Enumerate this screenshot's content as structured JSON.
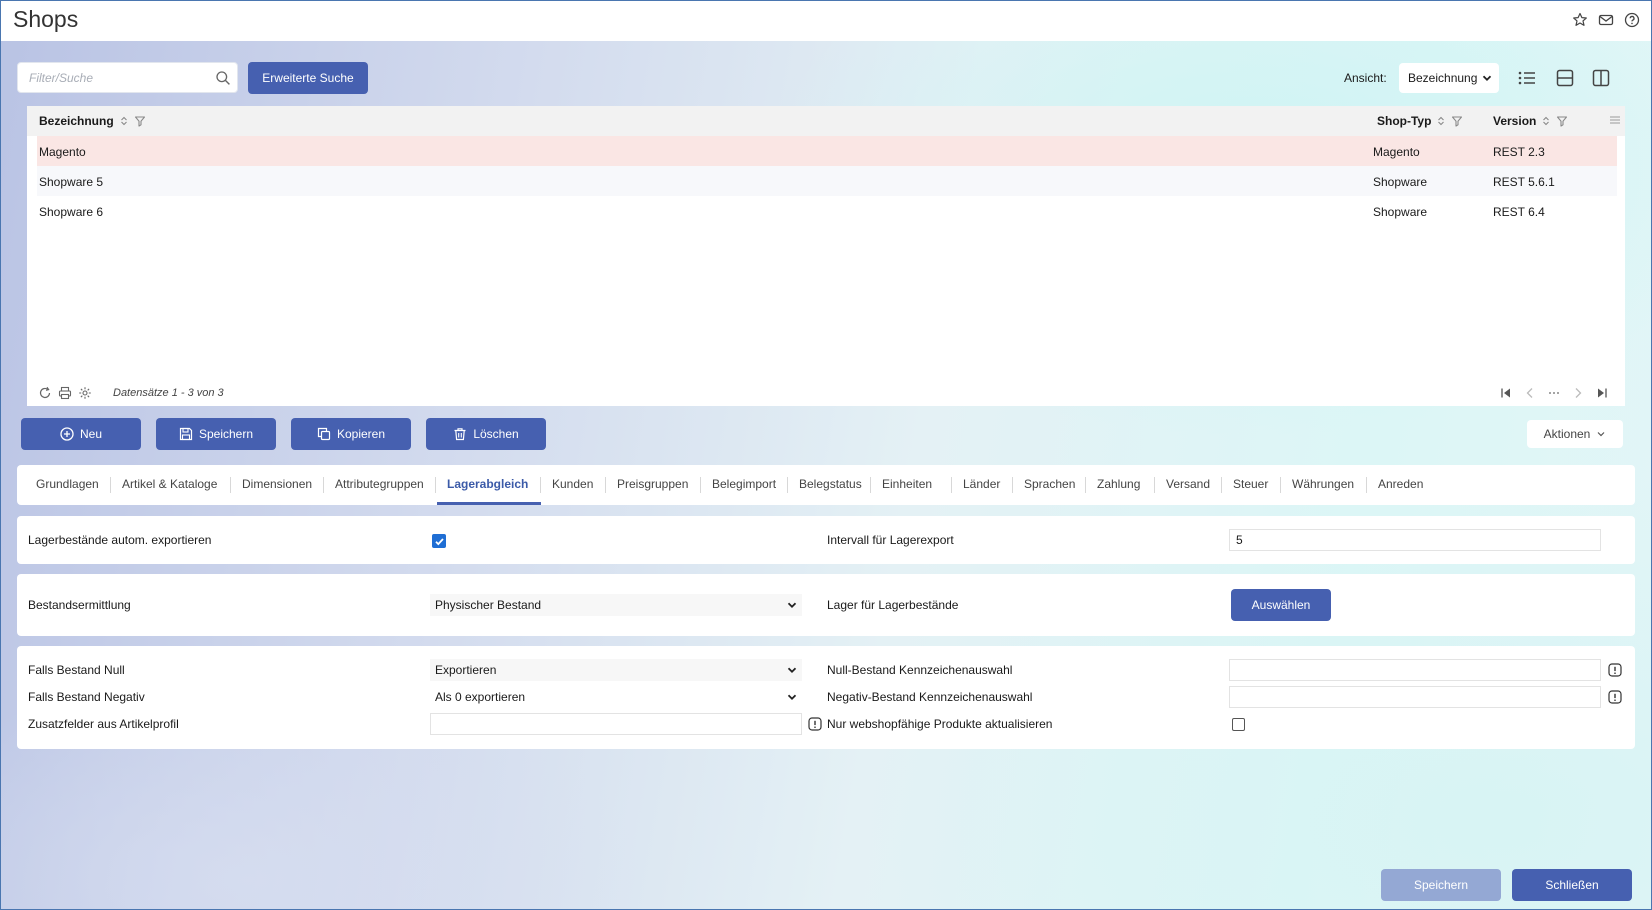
{
  "window": {
    "title": "Shops"
  },
  "search": {
    "placeholder": "Filter/Suche",
    "advanced_label": "Erweiterte Suche"
  },
  "view": {
    "label": "Ansicht:",
    "selected": "Bezeichnung"
  },
  "grid": {
    "columns": [
      "Bezeichnung",
      "Shop-Typ",
      "Version"
    ],
    "rows": [
      {
        "name": "Magento",
        "type": "Magento",
        "version": "REST 2.3",
        "selected": true
      },
      {
        "name": "Shopware 5",
        "type": "Shopware",
        "version": "REST 5.6.1",
        "selected": false
      },
      {
        "name": "Shopware 6",
        "type": "Shopware",
        "version": "REST 6.4",
        "selected": false
      }
    ],
    "records_text": "Datensätze 1 - 3 von 3"
  },
  "actions": {
    "new": "Neu",
    "save": "Speichern",
    "copy": "Kopieren",
    "delete": "Löschen",
    "more": "Aktionen"
  },
  "tabs": [
    "Grundlagen",
    "Artikel & Kataloge",
    "Dimensionen",
    "Attributegruppen",
    "Lagerabgleich",
    "Kunden",
    "Preisgruppen",
    "Belegimport",
    "Belegstatus",
    "Einheiten",
    "Länder",
    "Sprachen",
    "Zahlung",
    "Versand",
    "Steuer",
    "Währungen",
    "Anreden"
  ],
  "active_tab": "Lagerabgleich",
  "form": {
    "auto_export_label": "Lagerbestände autom. exportieren",
    "auto_export_checked": true,
    "interval_label": "Intervall für Lagerexport",
    "interval_value": "5",
    "stock_method_label": "Bestandsermittlung",
    "stock_method_value": "Physischer Bestand",
    "warehouse_label": "Lager für Lagerbestände",
    "warehouse_button": "Auswählen",
    "zero_label": "Falls Bestand Null",
    "zero_value": "Exportieren",
    "negative_label": "Falls Bestand Negativ",
    "negative_value": "Als 0 exportieren",
    "extra_fields_label": "Zusatzfelder aus Artikelprofil",
    "extra_fields_value": "",
    "zero_flag_label": "Null-Bestand Kennzeichenauswahl",
    "zero_flag_value": "",
    "negative_flag_label": "Negativ-Bestand Kennzeichenauswahl",
    "negative_flag_value": "",
    "webshop_only_label": "Nur webshopfähige Produkte aktualisieren",
    "webshop_only_checked": false
  },
  "footer": {
    "save": "Speichern",
    "close": "Schließen"
  },
  "colors": {
    "primary": "#4660b0",
    "selected_row": "#fae6e4",
    "checkbox": "#1f6ed4",
    "disabled_button": "#94a8d4"
  }
}
